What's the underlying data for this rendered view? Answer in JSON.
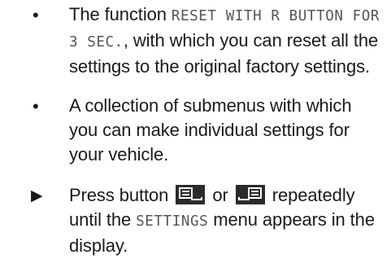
{
  "items": [
    {
      "marker": "•",
      "line1_before": "The function ",
      "line1_code": "RESET WITH R BUTTON FOR",
      "line2_code": "3 SEC.",
      "line2_after": ", with which you can reset all the",
      "line3": "settings to the original factory settings."
    },
    {
      "marker": "•",
      "lines": [
        "A collection of submenus with which",
        "you can make individual settings for",
        "your vehicle."
      ]
    },
    {
      "marker": "▶",
      "line1_before": "Press button",
      "line1_or": "or",
      "line1_after": "repeatedly",
      "line2_before": "until the ",
      "line2_code": "SETTINGS",
      "line2_after": " menu appears in the",
      "line3": "display."
    }
  ],
  "icons": {
    "previous_button": "display-previous-button-icon",
    "next_button": "display-next-button-icon"
  }
}
